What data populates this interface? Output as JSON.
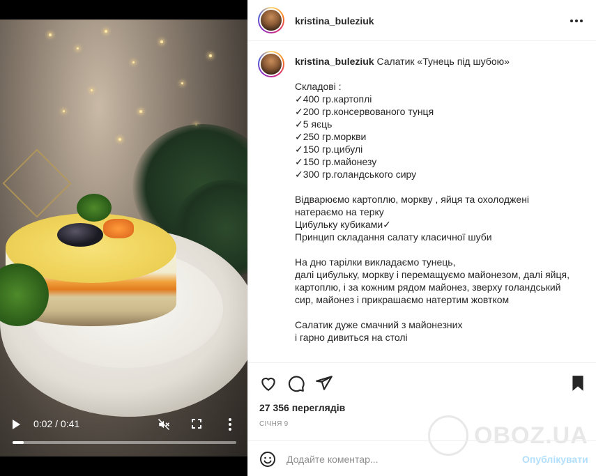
{
  "post": {
    "author": "kristina_buleziuk",
    "more_label": "..."
  },
  "video": {
    "current_time": "0:02",
    "duration": "0:41",
    "time_display": "0:02 / 0:41",
    "progress": 0.05
  },
  "caption": {
    "username": "kristina_buleziuk",
    "title": " Салатик «Тунець під шубою»",
    "lines": [
      "",
      "Складові :",
      "✓400 гр.картоплі",
      "✓200 гр.консервованого тунця",
      "✓5 яєць",
      "✓250 гр.моркви",
      "✓150 гр.цибулі",
      "✓150 гр.майонезу",
      "✓300 гр.голандського сиру",
      "",
      "Відварюємо картоплю, моркву , яйця та охолоджені",
      "натераємо на терку",
      "Цибульку кубиками✓",
      "Принцип складання салату класичної шуби",
      "",
      "На дно тарілки викладаємо тунець,",
      "далі цибульку, моркву і перемащуємо майонезом, далі яйця,",
      "картоплю, і за кожним рядом майонез, зверху голандський",
      "сир, майонез і прикрашаємо натертим жовтком",
      "",
      "Салатик дуже смачний з майонезних",
      "і гарно дивиться на столі",
      ""
    ]
  },
  "stats": {
    "views": "27 356 переглядів",
    "date": "січня 9"
  },
  "comment": {
    "placeholder": "Додайте коментар...",
    "publish_label": "Опублікувати"
  },
  "watermark": {
    "text": "OBOZ.UA"
  },
  "colors": {
    "link_disabled": "#b2dffc",
    "muted": "#8e8e8e",
    "text": "#262626",
    "border": "#efefef"
  }
}
